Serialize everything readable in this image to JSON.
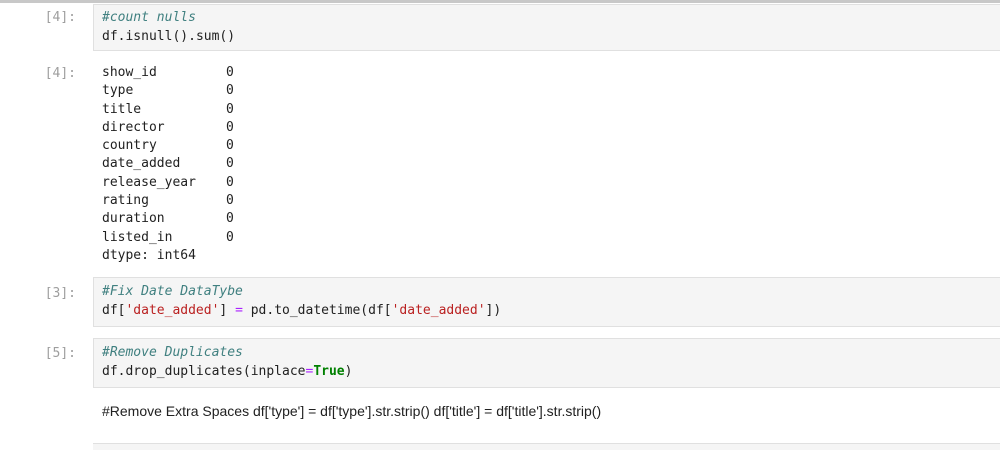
{
  "cells": [
    {
      "prompt": "[4]:",
      "lines": [
        [
          {
            "t": "#count nulls",
            "c": "comment"
          }
        ],
        [
          {
            "t": "df",
            "c": ""
          },
          {
            "t": ".",
            "c": ""
          },
          {
            "t": "isnull",
            "c": "fn"
          },
          {
            "t": "().",
            "c": ""
          },
          {
            "t": "sum",
            "c": "fn"
          },
          {
            "t": "()",
            "c": ""
          }
        ]
      ]
    },
    {
      "prompt": "[3]:",
      "lines": [
        [
          {
            "t": "#Fix Date DataTybe",
            "c": "comment"
          }
        ],
        [
          {
            "t": "df[",
            "c": ""
          },
          {
            "t": "'date_added'",
            "c": "str"
          },
          {
            "t": "] ",
            "c": ""
          },
          {
            "t": "=",
            "c": "op"
          },
          {
            "t": " pd.to_datetime(df[",
            "c": ""
          },
          {
            "t": "'date_added'",
            "c": "str"
          },
          {
            "t": "])",
            "c": ""
          }
        ]
      ]
    },
    {
      "prompt": "[5]:",
      "lines": [
        [
          {
            "t": "#Remove Duplicates",
            "c": "comment"
          }
        ],
        [
          {
            "t": "df.drop_duplicates(inplace",
            "c": ""
          },
          {
            "t": "=",
            "c": "op"
          },
          {
            "t": "True",
            "c": "kw"
          },
          {
            "t": ")",
            "c": ""
          }
        ]
      ]
    }
  ],
  "output": {
    "prompt": "[4]:",
    "rows": [
      {
        "name": "show_id",
        "value": "0"
      },
      {
        "name": "type",
        "value": "0"
      },
      {
        "name": "title",
        "value": "0"
      },
      {
        "name": "director",
        "value": "0"
      },
      {
        "name": "country",
        "value": "0"
      },
      {
        "name": "date_added",
        "value": "0"
      },
      {
        "name": "release_year",
        "value": "0"
      },
      {
        "name": "rating",
        "value": "0"
      },
      {
        "name": "duration",
        "value": "0"
      },
      {
        "name": "listed_in",
        "value": "0"
      }
    ],
    "dtype": "dtype: int64"
  },
  "markdown": {
    "text": "#Remove Extra Spaces df['type'] = df['type'].str.strip() df['title'] = df['title'].str.strip()"
  }
}
